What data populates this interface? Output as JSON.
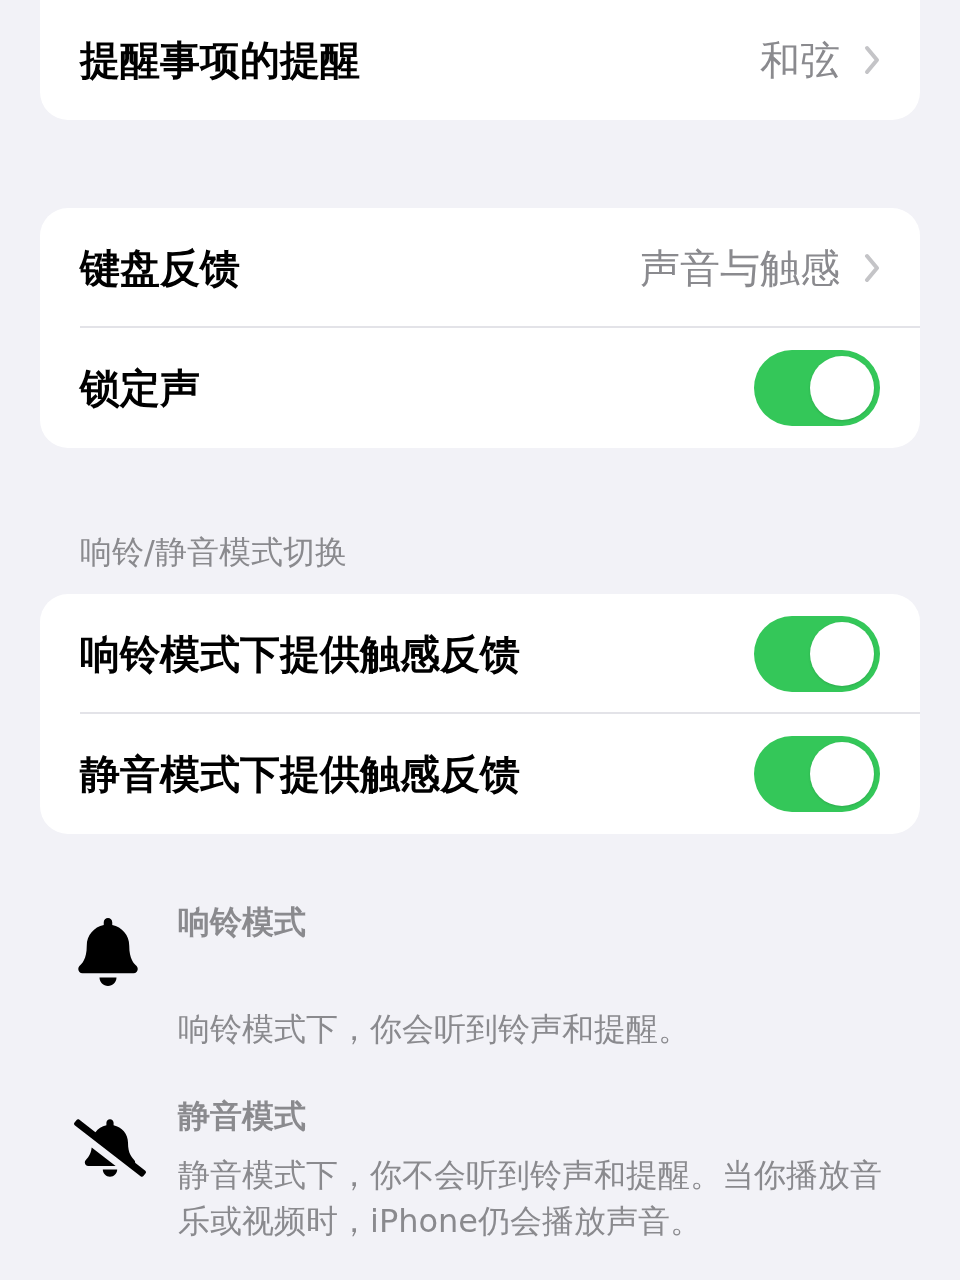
{
  "groups": [
    {
      "rows": [
        {
          "kind": "link",
          "label": "提醒事项的提醒",
          "value": "和弦"
        }
      ]
    },
    {
      "rows": [
        {
          "kind": "link",
          "label": "键盘反馈",
          "value": "声音与触感"
        },
        {
          "kind": "toggle",
          "label": "锁定声",
          "on": true
        }
      ]
    },
    {
      "header": "响铃/静音模式切换",
      "rows": [
        {
          "kind": "toggle",
          "label": "响铃模式下提供触感反馈",
          "on": true
        },
        {
          "kind": "toggle",
          "label": "静音模式下提供触感反馈",
          "on": true
        }
      ]
    }
  ],
  "modes": [
    {
      "kind": "ring",
      "title": "响铃模式",
      "text": "响铃模式下，你会听到铃声和提醒。"
    },
    {
      "kind": "silent",
      "title": "静音模式",
      "text": "静音模式下，你不会听到铃声和提醒。当你播放音乐或视频时，iPhone仍会播放声音。"
    }
  ]
}
